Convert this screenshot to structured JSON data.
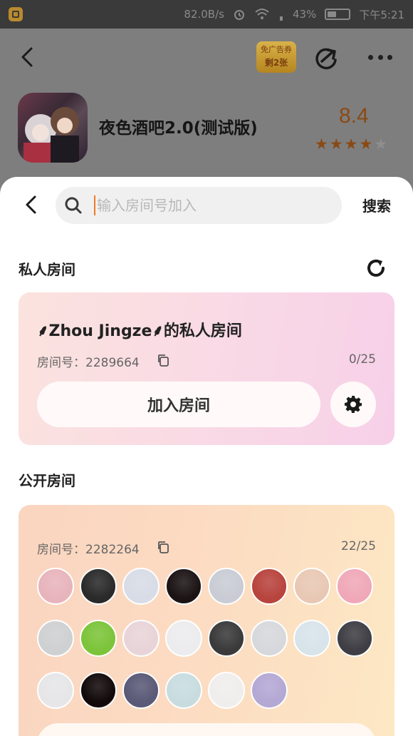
{
  "status_bar": {
    "speed": "82.0B/s",
    "battery": "43%",
    "battery_level": 0.43,
    "time": "下午5:21"
  },
  "app_header": {
    "ad_badge_line1": "免广告券",
    "ad_badge_line2": "剩2张",
    "game_title": "夜色酒吧2.0(测试版)",
    "rating": "8.4",
    "stars_filled": 4,
    "stars_total": 5
  },
  "search": {
    "placeholder": "输入房间号加入",
    "value": "",
    "submit_label": "搜索"
  },
  "private_section": {
    "title": "私人房间",
    "room": {
      "name": "⸙Zhou Jingze⸙的私人房间",
      "room_id_label": "房间号：2289664",
      "count": "0/25",
      "join_label": "加入房间"
    }
  },
  "public_section": {
    "title": "公开房间",
    "room": {
      "room_id_label": "房间号：2282264",
      "count": "22/25",
      "avatars": [
        {
          "color": "#e8b4bc"
        },
        {
          "color": "#2a2a2a"
        },
        {
          "color": "#d8dce6"
        },
        {
          "color": "#1c1414"
        },
        {
          "color": "#c9ccd4"
        },
        {
          "color": "#b8443e"
        },
        {
          "color": "#e8c8b4"
        },
        {
          "color": "#f0a8b8"
        },
        {
          "color": "#cfd0d2"
        },
        {
          "color": "#7cc43a"
        },
        {
          "color": "#e8d4d8"
        },
        {
          "color": "#ececee"
        },
        {
          "color": "#3a3a3a"
        },
        {
          "color": "#d6d8dc"
        },
        {
          "color": "#d8e4ea"
        },
        {
          "color": "#3e3e44"
        },
        {
          "color": "#e6e6e8"
        },
        {
          "color": "#120a0a"
        },
        {
          "color": "#5a5a78"
        },
        {
          "color": "#c8dce0"
        },
        {
          "color": "#f0eeec"
        },
        {
          "color": "#b4a8d4"
        }
      ]
    }
  },
  "colors": {
    "accent_caret": "#f07a2a",
    "rating": "#8a4a14"
  }
}
